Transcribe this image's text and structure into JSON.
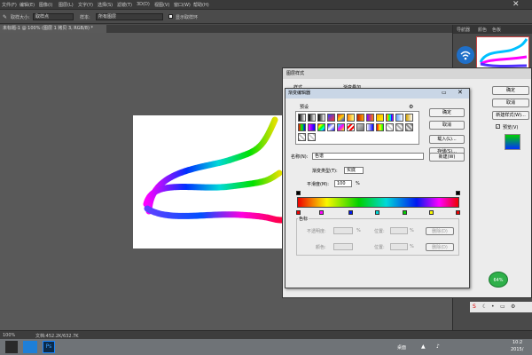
{
  "menu": [
    "文件(F)",
    "编辑(E)",
    "图像(I)",
    "图层(L)",
    "文字(Y)",
    "选择(S)",
    "滤镜(T)",
    "3D(D)",
    "视图(V)",
    "窗口(W)",
    "帮助(H)"
  ],
  "options": {
    "size_label": "取样大小:",
    "size_value": "取样点",
    "sample_label": "样本:",
    "sample_value": "所有图层",
    "ring_label": "显示取样环"
  },
  "doc_tab": "未标题-1 @ 100% (图层 1 拷贝 3, RGB/8) *",
  "status": {
    "zoom": "100%",
    "doc": "文档:452.2K/632.7K"
  },
  "taskbar": {
    "desktop": "桌面",
    "time": "10:2",
    "date": "2015/"
  },
  "right_tabs": [
    "导航器",
    "颜色",
    "色板"
  ],
  "layer_style": {
    "title": "图层样式",
    "style_label": "样式",
    "section": "渐变叠加",
    "ok": "确定",
    "cancel": "取消",
    "new_style": "新建样式(W)...",
    "preview": "预览(V)"
  },
  "gradient_editor": {
    "title": "渐变编辑器",
    "presets_label": "预设",
    "ok": "确定",
    "cancel": "取消",
    "load": "载入(L)...",
    "save": "存储(S)...",
    "name_label": "名称(N):",
    "name_value": "色谱",
    "new": "新建(W)",
    "type_label": "渐变类型(T):",
    "type_value": "实底",
    "smooth_label": "平滑度(M):",
    "smooth_value": "100",
    "smooth_unit": "%",
    "stops_label": "色标",
    "opacity_label": "不透明度:",
    "opacity_unit": "%",
    "pos_label": "位置:",
    "pos_unit": "%",
    "delete1": "删除(D)",
    "color_label": "颜色:",
    "pos2_label": "位置:",
    "pos2_unit": "%",
    "delete2": "删除(D)"
  },
  "colors": {
    "spectrum": [
      "#ff0000",
      "#ffff00",
      "#00ff00",
      "#00ffff",
      "#0000ff",
      "#ff00ff",
      "#ff0000"
    ]
  },
  "badge": "64%"
}
